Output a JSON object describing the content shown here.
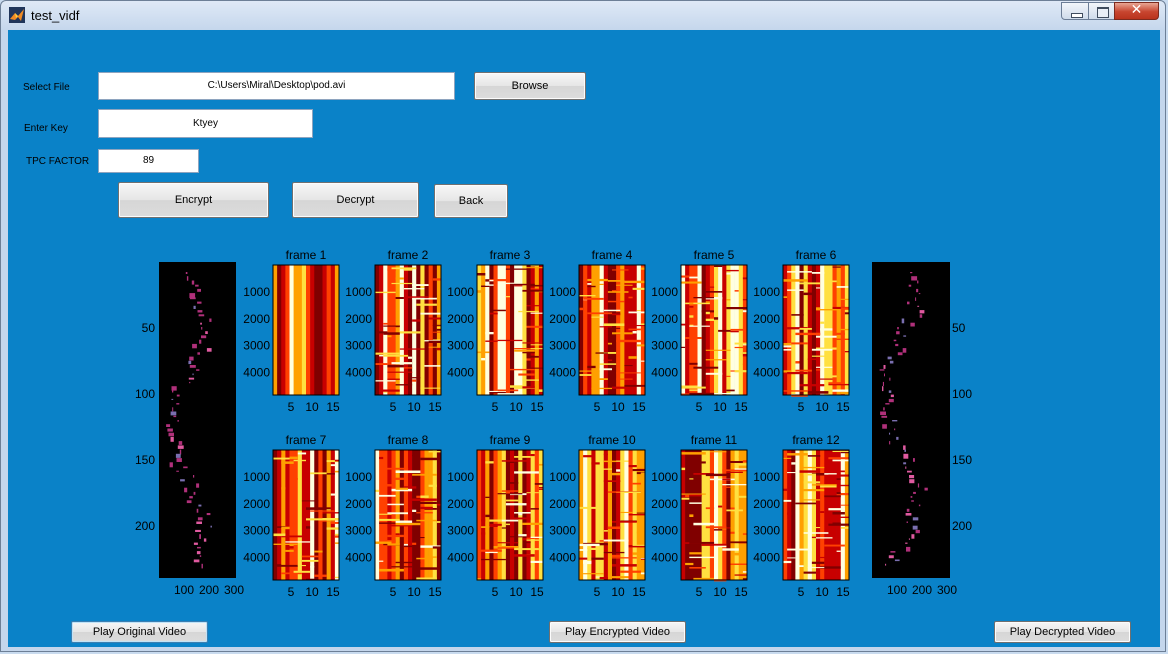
{
  "window": {
    "title": "test_vidf",
    "close_glyph": "✕"
  },
  "form": {
    "select_file_label": "Select File",
    "file_path": "C:\\Users\\Miral\\Desktop\\pod.avi",
    "browse_label": "Browse",
    "key_label": "Enter Key",
    "key_value": "Ktyey",
    "tpc_label": "TPC FACTOR",
    "tpc_value": "89",
    "encrypt_label": "Encrypt",
    "decrypt_label": "Decrypt",
    "back_label": "Back"
  },
  "playback": {
    "original_label": "Play Original Video",
    "encrypted_label": "Play Encrypted Video",
    "decrypted_label": "Play Decrypted Video"
  },
  "colors": {
    "panel_bg": "#0a82c8",
    "heat": [
      "#800000",
      "#c80000",
      "#ff4000",
      "#ffa000",
      "#ffe040",
      "#ffffe0"
    ]
  },
  "chart_data": [
    {
      "type": "image",
      "name": "original",
      "y_ticks": [
        "50",
        "100",
        "150",
        "200"
      ],
      "x_ticks": [
        "100",
        "200",
        "300"
      ]
    },
    {
      "type": "heatmap",
      "frames": [
        "frame 1",
        "frame 2",
        "frame 3",
        "frame 4",
        "frame 5",
        "frame 6",
        "frame 7",
        "frame 8",
        "frame 9",
        "frame 10",
        "frame 11",
        "frame 12"
      ],
      "y_ticks": [
        "1000",
        "2000",
        "3000",
        "4000"
      ],
      "x_ticks": [
        "5",
        "10",
        "15"
      ],
      "columns": 16
    },
    {
      "type": "image",
      "name": "decrypted",
      "y_ticks": [
        "50",
        "100",
        "150",
        "200"
      ],
      "x_ticks": [
        "100",
        "200",
        "300"
      ]
    }
  ]
}
